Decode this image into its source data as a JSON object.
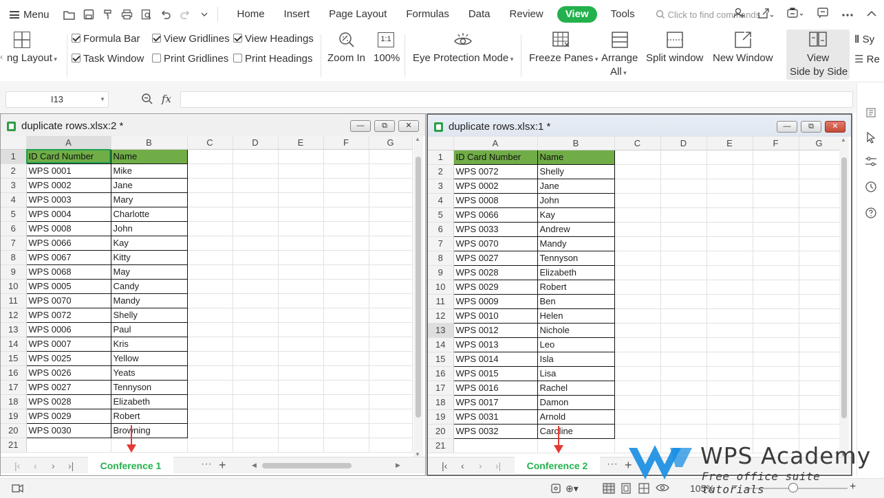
{
  "menubar": {
    "menu_label": "Menu",
    "tabs": [
      "Home",
      "Insert",
      "Page Layout",
      "Formulas",
      "Data",
      "Review",
      "View",
      "Tools"
    ],
    "active_tab": "View",
    "search_placeholder": "Click to find commands"
  },
  "ribbon": {
    "reading_layout_partial": "ng Layout",
    "formula_bar": "Formula Bar",
    "task_window": "Task Window",
    "view_gridlines": "View Gridlines",
    "print_gridlines": "Print Gridlines",
    "view_headings": "View Headings",
    "print_headings": "Print Headings",
    "zoom_in": "Zoom In",
    "zoom_100": "100%",
    "zoom_100_icon": "1:1",
    "eye_protection": "Eye Protection Mode",
    "freeze_panes": "Freeze Panes",
    "arrange_all_1": "Arrange",
    "arrange_all_2": "All",
    "split_window": "Split window",
    "new_window": "New Window",
    "view_side_1": "View",
    "view_side_2": "Side by Side",
    "sync_partial": "Sy",
    "reset_partial": "Re",
    "checks": {
      "formula_bar": true,
      "task_window": true,
      "view_gridlines": true,
      "print_gridlines": false,
      "view_headings": true,
      "print_headings": false
    }
  },
  "formula_bar": {
    "cell_ref": "I13",
    "fx": "fx"
  },
  "left_window": {
    "title": "duplicate rows.xlsx:2 *",
    "columns": [
      "A",
      "B",
      "C",
      "D",
      "E",
      "F",
      "G"
    ],
    "header": [
      "ID Card Number",
      "Name"
    ],
    "rows": [
      [
        "WPS 0001",
        "Mike"
      ],
      [
        "WPS 0002",
        "Jane"
      ],
      [
        "WPS 0003",
        "Mary"
      ],
      [
        "WPS 0004",
        "Charlotte"
      ],
      [
        "WPS 0008",
        "John"
      ],
      [
        "WPS 0066",
        "Kay"
      ],
      [
        "WPS 0067",
        "Kitty"
      ],
      [
        "WPS 0068",
        "May"
      ],
      [
        "WPS 0005",
        "Candy"
      ],
      [
        "WPS 0070",
        "Mandy"
      ],
      [
        "WPS 0072",
        "Shelly"
      ],
      [
        "WPS 0006",
        "Paul"
      ],
      [
        "WPS 0007",
        "Kris"
      ],
      [
        "WPS 0025",
        "Yellow"
      ],
      [
        "WPS 0026",
        "Yeats"
      ],
      [
        "WPS 0027",
        "Tennyson"
      ],
      [
        "WPS 0028",
        "Elizabeth"
      ],
      [
        "WPS 0029",
        "Robert"
      ],
      [
        "WPS 0030",
        "Browning"
      ]
    ],
    "row_numbers": [
      "1",
      "2",
      "3",
      "4",
      "5",
      "6",
      "7",
      "8",
      "9",
      "10",
      "11",
      "12",
      "13",
      "14",
      "15",
      "16",
      "17",
      "18",
      "19",
      "20",
      "21"
    ],
    "sheet_tab": "Conference 1"
  },
  "right_window": {
    "title": "duplicate rows.xlsx:1 *",
    "columns": [
      "A",
      "B",
      "C",
      "D",
      "E",
      "F",
      "G"
    ],
    "header": [
      "ID Card Number",
      "Name"
    ],
    "rows": [
      [
        "WPS 0072",
        "Shelly"
      ],
      [
        "WPS 0002",
        "Jane"
      ],
      [
        "WPS 0008",
        "John"
      ],
      [
        "WPS 0066",
        "Kay"
      ],
      [
        "WPS 0033",
        "Andrew"
      ],
      [
        "WPS 0070",
        "Mandy"
      ],
      [
        "WPS 0027",
        "Tennyson"
      ],
      [
        "WPS 0028",
        "Elizabeth"
      ],
      [
        "WPS 0029",
        "Robert"
      ],
      [
        "WPS 0009",
        "Ben"
      ],
      [
        "WPS 0010",
        "Helen"
      ],
      [
        "WPS 0012",
        "Nichole"
      ],
      [
        "WPS 0013",
        "Leo"
      ],
      [
        "WPS 0014",
        "Isla"
      ],
      [
        "WPS 0015",
        "Lisa"
      ],
      [
        "WPS 0016",
        "Rachel"
      ],
      [
        "WPS 0017",
        "Damon"
      ],
      [
        "WPS 0031",
        "Arnold"
      ],
      [
        "WPS 0032",
        "Caroline"
      ]
    ],
    "row_numbers": [
      "1",
      "2",
      "3",
      "4",
      "5",
      "6",
      "7",
      "8",
      "9",
      "10",
      "11",
      "12",
      "13",
      "14",
      "15",
      "16",
      "17",
      "18",
      "19",
      "20",
      "21"
    ],
    "sheet_tab": "Conference 2"
  },
  "status": {
    "zoom": "105%",
    "minus": "−",
    "plus": "+"
  },
  "watermark": {
    "title": "WPS Academy",
    "subtitle": "Free office suite tutorials"
  },
  "colors": {
    "accent": "#22b14c",
    "header_fill": "#70ad47",
    "arrow": "#e53935"
  }
}
